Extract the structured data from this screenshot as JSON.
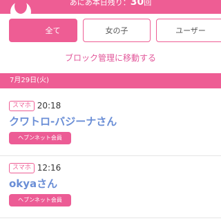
{
  "header": {
    "message_prefix": "あにあ本日残り：",
    "remaining_count": "30",
    "message_suffix": "回"
  },
  "tabs": [
    {
      "label": "全て",
      "active": true
    },
    {
      "label": "女の子",
      "active": false
    },
    {
      "label": "ユーザー",
      "active": false
    }
  ],
  "block_link": "ブロック管理に移動する",
  "date_header": "7月29日(火)",
  "entries": [
    {
      "device": "スマホ",
      "time": "20:18",
      "name": "クワトロ-バジーナさん",
      "badge": "ヘブンネット会員"
    },
    {
      "device": "スマホ",
      "time": "12:16",
      "name": "okyaさん",
      "badge": "ヘブンネット会員"
    }
  ],
  "colors": {
    "accent": "#ee5d94",
    "name_link": "#6a8ed6",
    "link_text": "#e2579a"
  }
}
